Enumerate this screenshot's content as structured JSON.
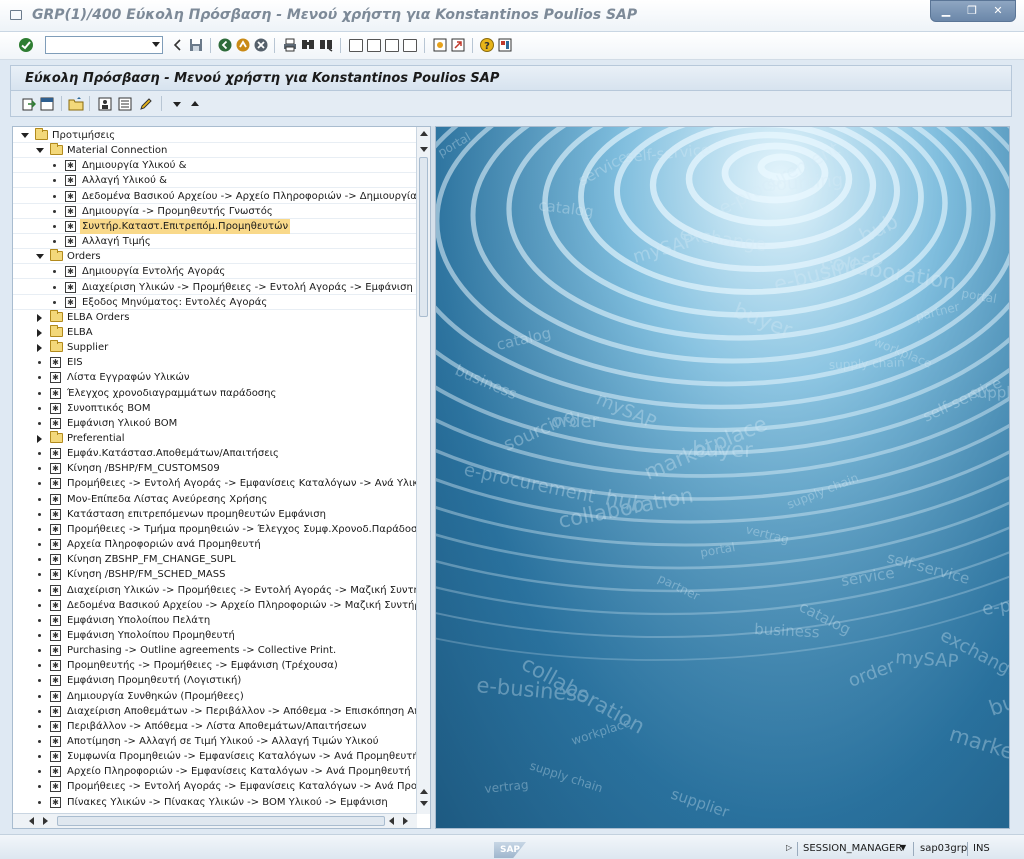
{
  "window": {
    "title": "GRP(1)/400 Εύκολη Πρόσβαση -  Μενού χρήστη για Konstantinos Poulios SAP",
    "controls": [
      "minimize-icon",
      "restore-icon",
      "close-icon"
    ]
  },
  "system_toolbar": {
    "command_field_value": "",
    "icons": [
      "enter-icon",
      "back-icon",
      "save-icon",
      "back-green-icon",
      "exit-icon",
      "cancel-icon",
      "print-icon",
      "find-icon",
      "find-next-icon",
      "first-page-icon",
      "previous-page-icon",
      "next-page-icon",
      "last-page-icon",
      "new-session-icon",
      "shortcut-icon",
      "help-icon",
      "layout-menu-icon"
    ]
  },
  "screen": {
    "title": "Εύκολη Πρόσβαση -  Μενού χρήστη για Konstantinos Poulios SAP"
  },
  "app_toolbar": {
    "icons": [
      "other-menu-icon",
      "sap-menu-icon",
      "add-favorites-icon",
      "create-role-icon",
      "assign-users-icon",
      "change-icon",
      "move-down-icon",
      "move-up-icon"
    ]
  },
  "tree": {
    "rows": [
      {
        "type": "folder",
        "level": 0,
        "state": "open",
        "label": "Προτιμήσεις"
      },
      {
        "type": "folder",
        "level": 1,
        "state": "open",
        "label": "Material Connection"
      },
      {
        "type": "tx",
        "level": 2,
        "label": "Δημιουργία Υλικού &"
      },
      {
        "type": "tx",
        "level": 2,
        "label": "Αλλαγή Υλικού &"
      },
      {
        "type": "tx",
        "level": 2,
        "label": "Δεδομένα Βασικού Αρχείου -> Αρχείο Πληροφοριών -> Δημιουργία"
      },
      {
        "type": "tx",
        "level": 2,
        "label": "Δημιουργία -> Προμηθευτής Γνωστός"
      },
      {
        "type": "tx",
        "level": 2,
        "label": "Συντήρ.Καταστ.Επιτρεπόμ.Προμηθευτών",
        "selected": true
      },
      {
        "type": "tx",
        "level": 2,
        "label": "Αλλαγή Τιμής"
      },
      {
        "type": "folder",
        "level": 1,
        "state": "open",
        "label": "Orders"
      },
      {
        "type": "tx",
        "level": 2,
        "label": "Δημιουργία Εντολής Αγοράς"
      },
      {
        "type": "tx",
        "level": 2,
        "label": "Διαχείριση Υλικών -> Προμήθειες -> Εντολή Αγοράς -> Εμφάνιση"
      },
      {
        "type": "tx",
        "level": 2,
        "label": "Εξοδος Μηνύματος: Εντολές Αγοράς"
      },
      {
        "type": "folder",
        "level": 1,
        "state": "closed",
        "label": "ELBA Orders"
      },
      {
        "type": "folder",
        "level": 1,
        "state": "closed",
        "label": "ELBA"
      },
      {
        "type": "folder",
        "level": 1,
        "state": "closed",
        "label": "Supplier"
      },
      {
        "type": "tx",
        "level": 1,
        "label": "EIS"
      },
      {
        "type": "tx",
        "level": 1,
        "label": "Λίστα Εγγραφών Υλικών"
      },
      {
        "type": "tx",
        "level": 1,
        "label": "Έλεγχος χρονοδιαγραμμάτων παράδοσης"
      },
      {
        "type": "tx",
        "level": 1,
        "label": "Συνοπτικός BOM"
      },
      {
        "type": "tx",
        "level": 1,
        "label": "Εμφάνιση Υλικού BOM"
      },
      {
        "type": "folder",
        "level": 1,
        "state": "closed",
        "label": "Preferential"
      },
      {
        "type": "tx",
        "level": 1,
        "label": "Εμφάν.Κατάστασ.Αποθεμάτων/Απαιτήσεις"
      },
      {
        "type": "tx",
        "level": 1,
        "label": "Κίνηση /BSHP/FM_CUSTOMS09"
      },
      {
        "type": "tx",
        "level": 1,
        "label": "Προμήθειες -> Εντολή Αγοράς -> Εμφανίσεις Καταλόγων -> Ανά Υλικό"
      },
      {
        "type": "tx",
        "level": 1,
        "label": "Μον-Επίπεδα Λίστας Ανεύρεσης Χρήσης"
      },
      {
        "type": "tx",
        "level": 1,
        "label": "Κατάσταση επιτρεπόμενων προμηθευτών Εμφάνιση"
      },
      {
        "type": "tx",
        "level": 1,
        "label": "Προμήθειες -> Τμήμα προμηθειών -> Έλεγχος Συμφ.Χρονοδ.Παράδοσης"
      },
      {
        "type": "tx",
        "level": 1,
        "label": "Αρχεία Πληροφοριών ανά Προμηθευτή"
      },
      {
        "type": "tx",
        "level": 1,
        "label": "Κίνηση ZBSHP_FM_CHANGE_SUPL"
      },
      {
        "type": "tx",
        "level": 1,
        "label": "Κίνηση /BSHP/FM_SCHED_MASS"
      },
      {
        "type": "tx",
        "level": 1,
        "label": "Διαχείριση Υλικών -> Προμήθειες -> Εντολή Αγοράς -> Μαζική Συντήρηση"
      },
      {
        "type": "tx",
        "level": 1,
        "label": "Δεδομένα Βασικού Αρχείου -> Αρχείο Πληροφοριών -> Μαζική Συντήρηση"
      },
      {
        "type": "tx",
        "level": 1,
        "label": "Εμφάνιση Υπολοίπου Πελάτη"
      },
      {
        "type": "tx",
        "level": 1,
        "label": "Εμφάνιση Υπολοίπου Προμηθευτή"
      },
      {
        "type": "tx",
        "level": 1,
        "label": "Purchasing -> Outline agreements -> Collective Print."
      },
      {
        "type": "tx",
        "level": 1,
        "label": "Προμηθευτής -> Προμήθειες -> Εμφάνιση (Τρέχουσα)"
      },
      {
        "type": "tx",
        "level": 1,
        "label": "Εμφάνιση Προμηθευτή (Λογιστική)"
      },
      {
        "type": "tx",
        "level": 1,
        "label": "Δημιουργία Συνθηκών (Προμήθεες)"
      },
      {
        "type": "tx",
        "level": 1,
        "label": "Διαχείριση Αποθεμάτων -> Περιβάλλον -> Απόθεμα -> Επισκόπηση Αποθέματ"
      },
      {
        "type": "tx",
        "level": 1,
        "label": "Περιβάλλον -> Απόθεμα -> Λίστα Αποθεμάτων/Απαιτήσεων"
      },
      {
        "type": "tx",
        "level": 1,
        "label": "Αποτίμηση -> Αλλαγή σε Τιμή Υλικού -> Αλλαγή Τιμών Υλικού"
      },
      {
        "type": "tx",
        "level": 1,
        "label": "Συμφωνία Προμηθειών -> Εμφανίσεις Καταλόγων -> Ανά Προμηθευτή"
      },
      {
        "type": "tx",
        "level": 1,
        "label": "Αρχείο Πληροφοριών -> Εμφανίσεις Καταλόγων -> Ανά Προμηθευτή"
      },
      {
        "type": "tx",
        "level": 1,
        "label": "Προμήθειες -> Εντολή Αγοράς -> Εμφανίσεις Καταλόγων -> Ανά Προμηθευτ"
      },
      {
        "type": "tx",
        "level": 1,
        "label": "Πίνακες Υλικών -> Πίνακας Υλικών -> BOM Υλικού -> Εμφάνιση"
      }
    ]
  },
  "image_panel": {
    "words": [
      "portal",
      "catalog",
      "mySAP",
      "buyer",
      "supply chain",
      "self-service",
      "e-procurement",
      "collaboration",
      "partner",
      "business",
      "order",
      "marketplace",
      "vertrag",
      "service",
      "exchange",
      "e-business",
      "workplace",
      "supplier",
      "sourcing",
      "hub"
    ]
  },
  "statusbar": {
    "logo": "SAP",
    "session": "SESSION_MANAGER",
    "server": "sap03grp",
    "mode": "INS"
  }
}
